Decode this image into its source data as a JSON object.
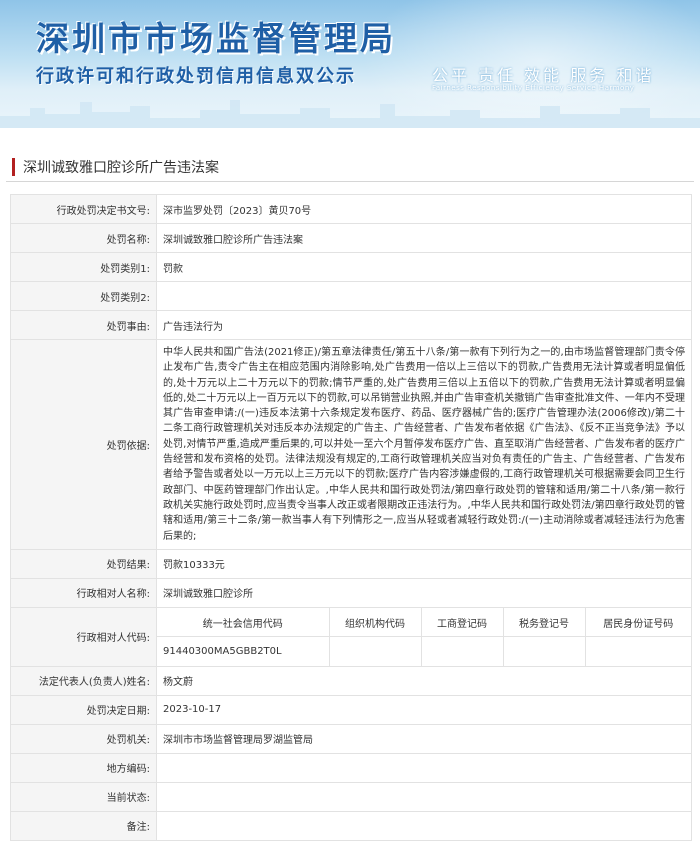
{
  "banner": {
    "title": "深圳市市场监督管理局",
    "subtitle": "行政许可和行政处罚信用信息双公示",
    "slogan": "公平  责任  效能  服务  和谐",
    "slogan_en": "Fairness  Responsibility  Efficiency  Service  Harmony"
  },
  "case": {
    "title": "深圳诚致雅口腔诊所广告违法案"
  },
  "fields": {
    "decision_no": {
      "label": "行政处罚决定书文号:",
      "value": "深市监罗处罚〔2023〕黄贝70号"
    },
    "penalty_name": {
      "label": "处罚名称:",
      "value": "深圳诚致雅口腔诊所广告违法案"
    },
    "category1": {
      "label": "处罚类别1:",
      "value": "罚款"
    },
    "category2": {
      "label": "处罚类别2:",
      "value": ""
    },
    "reason": {
      "label": "处罚事由:",
      "value": "广告违法行为"
    },
    "basis": {
      "label": "处罚依据:",
      "value": "中华人民共和国广告法(2021修正)/第五章法律责任/第五十八条/第一款有下列行为之一的,由市场监督管理部门责令停止发布广告,责令广告主在相应范围内消除影响,处广告费用一倍以上三倍以下的罚款,广告费用无法计算或者明显偏低的,处十万元以上二十万元以下的罚款;情节严重的,处广告费用三倍以上五倍以下的罚款,广告费用无法计算或者明显偏低的,处二十万元以上一百万元以下的罚款,可以吊销营业执照,并由广告审查机关撤销广告审查批准文件、一年内不受理其广告审查申请:/(一)违反本法第十六条规定发布医疗、药品、医疗器械广告的;医疗广告管理办法(2006修改)/第二十二条工商行政管理机关对违反本办法规定的广告主、广告经营者、广告发布者依据《广告法》、《反不正当竞争法》予以处罚,对情节严重,造成严重后果的,可以并处一至六个月暂停发布医疗广告、直至取消广告经营者、广告发布者的医疗广告经营和发布资格的处罚。法律法规没有规定的,工商行政管理机关应当对负有责任的广告主、广告经营者、广告发布者给予警告或者处以一万元以上三万元以下的罚款;医疗广告内容涉嫌虚假的,工商行政管理机关可根据需要会同卫生行政部门、中医药管理部门作出认定。,中华人民共和国行政处罚法/第四章行政处罚的管辖和适用/第二十八条/第一款行政机关实施行政处罚时,应当责令当事人改正或者限期改正违法行为。,中华人民共和国行政处罚法/第四章行政处罚的管辖和适用/第三十二条/第一款当事人有下列情形之一,应当从轻或者减轻行政处罚:/(一)主动消除或者减轻违法行为危害后果的;"
    },
    "result": {
      "label": "处罚结果:",
      "value": "罚款10333元"
    },
    "party": {
      "label": "行政相对人名称:",
      "value": "深圳诚致雅口腔诊所"
    },
    "party_code": {
      "label": "行政相对人代码:",
      "headers": [
        "统一社会信用代码",
        "组织机构代码",
        "工商登记码",
        "税务登记号",
        "居民身份证号码"
      ],
      "values": [
        "91440300MA5GBB2T0L",
        "",
        "",
        "",
        ""
      ]
    },
    "legal_rep": {
      "label": "法定代表人(负责人)姓名:",
      "value": "杨文蔚"
    },
    "decision_date": {
      "label": "处罚决定日期:",
      "value": "2023-10-17"
    },
    "authority": {
      "label": "处罚机关:",
      "value": "深圳市市场监督管理局罗湖监管局"
    },
    "local_code": {
      "label": "地方编码:",
      "value": ""
    },
    "status": {
      "label": "当前状态:",
      "value": ""
    },
    "remark": {
      "label": "备注:",
      "value": ""
    }
  }
}
